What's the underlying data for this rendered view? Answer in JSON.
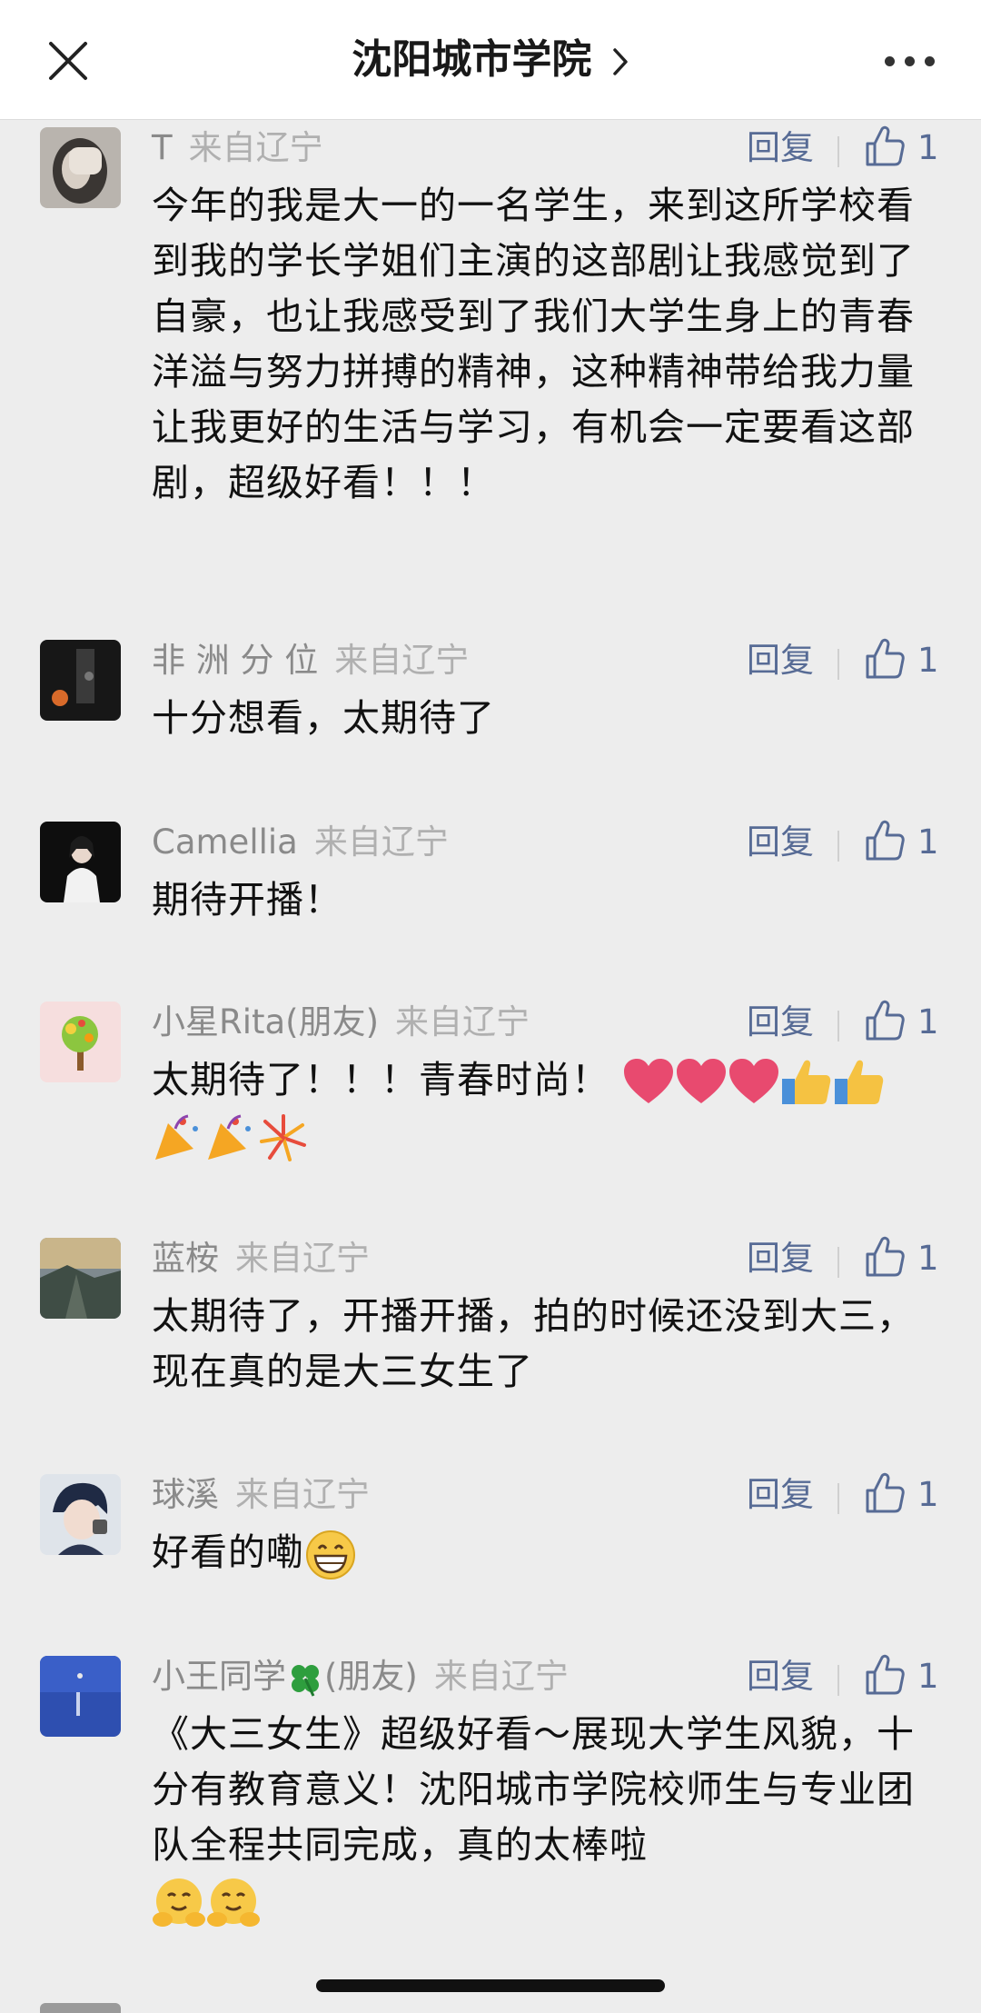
{
  "header": {
    "title": "沈阳城市学院"
  },
  "labels": {
    "reply": "回复"
  },
  "comments": [
    {
      "name": "T",
      "from": "来自辽宁",
      "likes": "1",
      "text": "今年的我是大一的一名学生，来到这所学校看到我的学长学姐们主演的这部剧让我感觉到了自豪，也让我感受到了我们大学生身上的青春洋溢与努力拼搏的精神，这种精神带给我力量让我更好的生活与学习，有机会一定要看这部剧，超级好看！！！"
    },
    {
      "name": "非 洲 分 位",
      "from": "来自辽宁",
      "likes": "1",
      "text": "十分想看，太期待了"
    },
    {
      "name": "Camellia",
      "from": "来自辽宁",
      "likes": "1",
      "text": "期待开播！"
    },
    {
      "name": "小星Rita(朋友)",
      "from": "来自辽宁",
      "likes": "1",
      "text": "太期待了！！！青春时尚！"
    },
    {
      "name": "蓝桉",
      "from": "来自辽宁",
      "likes": "1",
      "text": "太期待了，开播开播，拍的时候还没到大三，现在真的是大三女生了"
    },
    {
      "name": "球溪",
      "from": "来自辽宁",
      "likes": "1",
      "text": "好看的嘞"
    },
    {
      "name_part1": "小王同学",
      "name_part2": "(朋友)",
      "from": "来自辽宁",
      "likes": "1",
      "text": "《大三女生》超级好看～展现大学生风貌，十分有教育意义！沈阳城市学院校师生与专业团队全程共同完成，真的太棒啦"
    }
  ],
  "colors": {
    "link": "#576b95",
    "background": "#ededed",
    "meta": "#8a8a8a"
  }
}
